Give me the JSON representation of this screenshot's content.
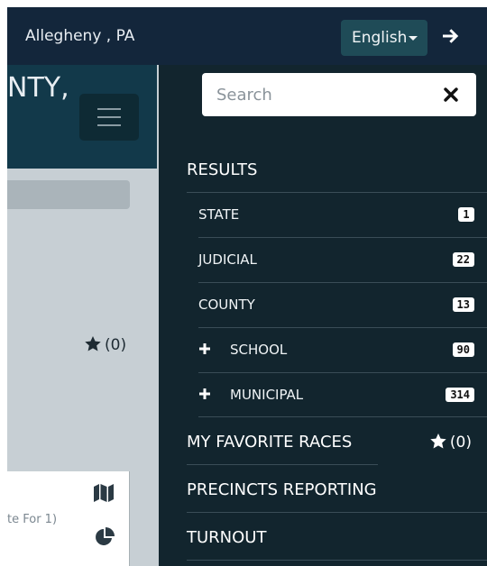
{
  "header": {
    "location": "Allegheny , PA",
    "language_label": "English",
    "go_icon": "arrow-right-icon"
  },
  "left_panel": {
    "title_fragment": "NTY,",
    "menu_icon": "hamburger-icon",
    "favorites_count": "(0)",
    "card_text": "te For 1)",
    "card_icons": [
      "map-icon",
      "pie-chart-icon"
    ]
  },
  "search": {
    "placeholder": "Search",
    "close_icon": "close-icon"
  },
  "nav": {
    "results_label": "RESULTS",
    "items": [
      {
        "label": "STATE",
        "count": "1",
        "expandable": false
      },
      {
        "label": "JUDICIAL",
        "count": "22",
        "expandable": false
      },
      {
        "label": "COUNTY",
        "count": "13",
        "expandable": false
      },
      {
        "label": "SCHOOL",
        "count": "90",
        "expandable": true
      },
      {
        "label": "MUNICIPAL",
        "count": "314",
        "expandable": true
      }
    ],
    "favorites_label": "MY FAVORITE RACES",
    "favorites_count": "(0)",
    "precincts_label": "PRECINCTS REPORTING",
    "turnout_label": "TURNOUT"
  },
  "colors": {
    "topbar": "#13263b",
    "drawer": "#12252e",
    "left_header": "#12394a",
    "language_button": "#1f4b57"
  }
}
